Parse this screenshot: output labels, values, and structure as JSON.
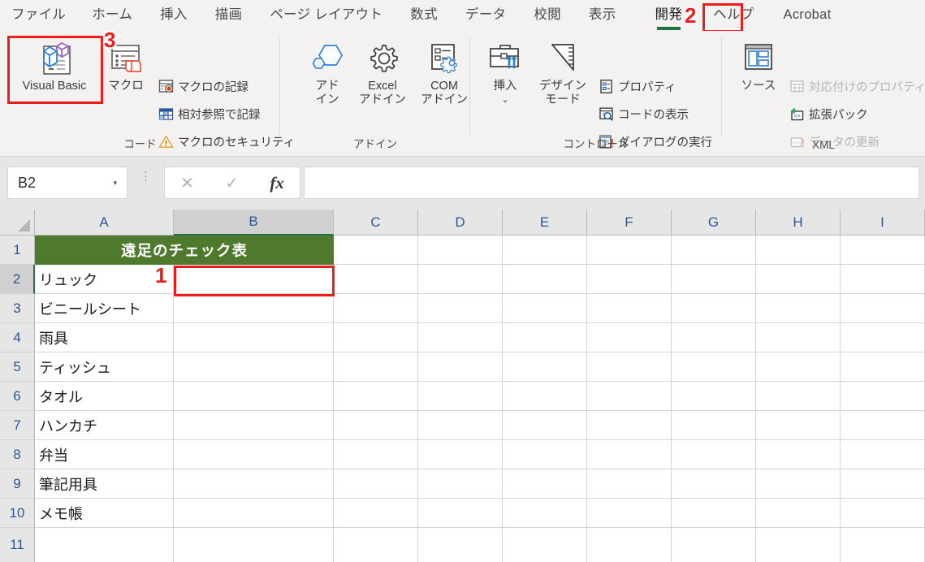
{
  "ribbon": {
    "tabs": [
      {
        "label": "ファイル",
        "active": false
      },
      {
        "label": "ホーム",
        "active": false
      },
      {
        "label": "挿入",
        "active": false
      },
      {
        "label": "描画",
        "active": false
      },
      {
        "label": "ページ レイアウト",
        "active": false
      },
      {
        "label": "数式",
        "active": false
      },
      {
        "label": "データ",
        "active": false
      },
      {
        "label": "校閲",
        "active": false
      },
      {
        "label": "表示",
        "active": false
      },
      {
        "label": "開発",
        "active": true
      },
      {
        "label": "ヘルプ",
        "active": false
      },
      {
        "label": "Acrobat",
        "active": false
      }
    ],
    "groups": {
      "code": {
        "label": "コード",
        "visual_basic": "Visual Basic",
        "macro": "マクロ",
        "record_macro": "マクロの記録",
        "relative_reference": "相対参照で記録",
        "macro_security": "マクロのセキュリティ"
      },
      "addins": {
        "label": "アドイン",
        "addin_line1": "アド",
        "addin_line2": "イン",
        "excel_line1": "Excel",
        "excel_line2": "アドイン",
        "com_line1": "COM",
        "com_line2": "アドイン"
      },
      "controls": {
        "label": "コントロール",
        "insert": "挿入",
        "design_line1": "デザイン",
        "design_line2": "モード",
        "properties": "プロパティ",
        "view_code": "コードの表示",
        "run_dialog": "ダイアログの実行"
      },
      "xml": {
        "label": "XML",
        "source": "ソース",
        "map_properties": "対応付けのプロパティ",
        "expansion_packs": "拡張パック",
        "refresh_data": "データの更新"
      }
    }
  },
  "formula_bar": {
    "name_box_value": "B2",
    "name_box_caret": "▾",
    "cancel": "✕",
    "enter": "✓",
    "insert_function": "fx",
    "formula_value": ""
  },
  "sheet": {
    "columns": [
      "A",
      "B",
      "C",
      "D",
      "E",
      "F",
      "G",
      "H",
      "I"
    ],
    "rows": [
      "1",
      "2",
      "3",
      "4",
      "5",
      "6",
      "7",
      "8",
      "9",
      "10",
      "11"
    ],
    "selected_cell": "B2",
    "selected_column": "B",
    "selected_row": "2",
    "merged_title": "遠足のチェック表",
    "title_fill_color": "#4f7a2e",
    "column_a_values": [
      "リュック",
      "ビニールシート",
      "雨具",
      "ティッシュ",
      "タオル",
      "ハンカチ",
      "弁当",
      "筆記用具",
      "メモ帳",
      ""
    ]
  },
  "annotations": {
    "marker_1": "1",
    "marker_2": "2",
    "marker_3": "3",
    "color": "#ee1c1c"
  }
}
